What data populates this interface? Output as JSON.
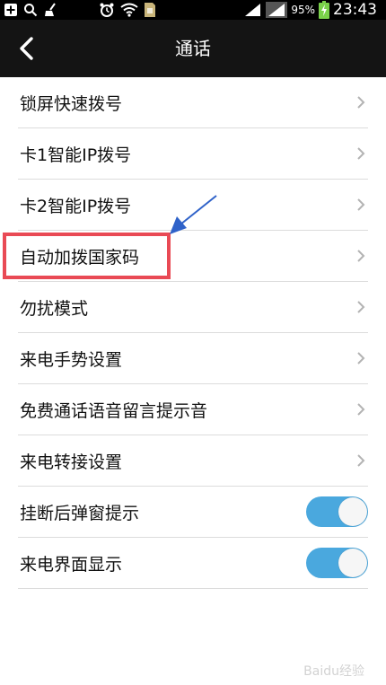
{
  "status_bar": {
    "battery_percent": "95%",
    "time": "23:43",
    "icons": [
      "add-icon",
      "search-icon",
      "broom-icon",
      "alarm-icon",
      "wifi-icon",
      "sim-icon",
      "signal-icon",
      "battery-icon"
    ]
  },
  "header": {
    "title": "通话",
    "back_icon": "back-arrow-icon"
  },
  "settings": [
    {
      "label": "锁屏快速拨号",
      "control": "chevron"
    },
    {
      "label": "卡1智能IP拨号",
      "control": "chevron"
    },
    {
      "label": "卡2智能IP拨号",
      "control": "chevron"
    },
    {
      "label": "自动加拨国家码",
      "control": "chevron",
      "highlighted": true
    },
    {
      "label": "勿扰模式",
      "control": "chevron"
    },
    {
      "label": "来电手势设置",
      "control": "chevron"
    },
    {
      "label": "免费通话语音留言提示音",
      "control": "chevron"
    },
    {
      "label": "来电转接设置",
      "control": "chevron"
    },
    {
      "label": "挂断后弹窗提示",
      "control": "toggle",
      "on": true
    },
    {
      "label": "来电界面显示",
      "control": "toggle",
      "on": true
    }
  ],
  "watermark": "Baidu经验",
  "colors": {
    "header_bg": "#141414",
    "toggle_on": "#4aa8de",
    "highlight_border": "#e94a55",
    "annotation_arrow": "#2f62c9"
  }
}
